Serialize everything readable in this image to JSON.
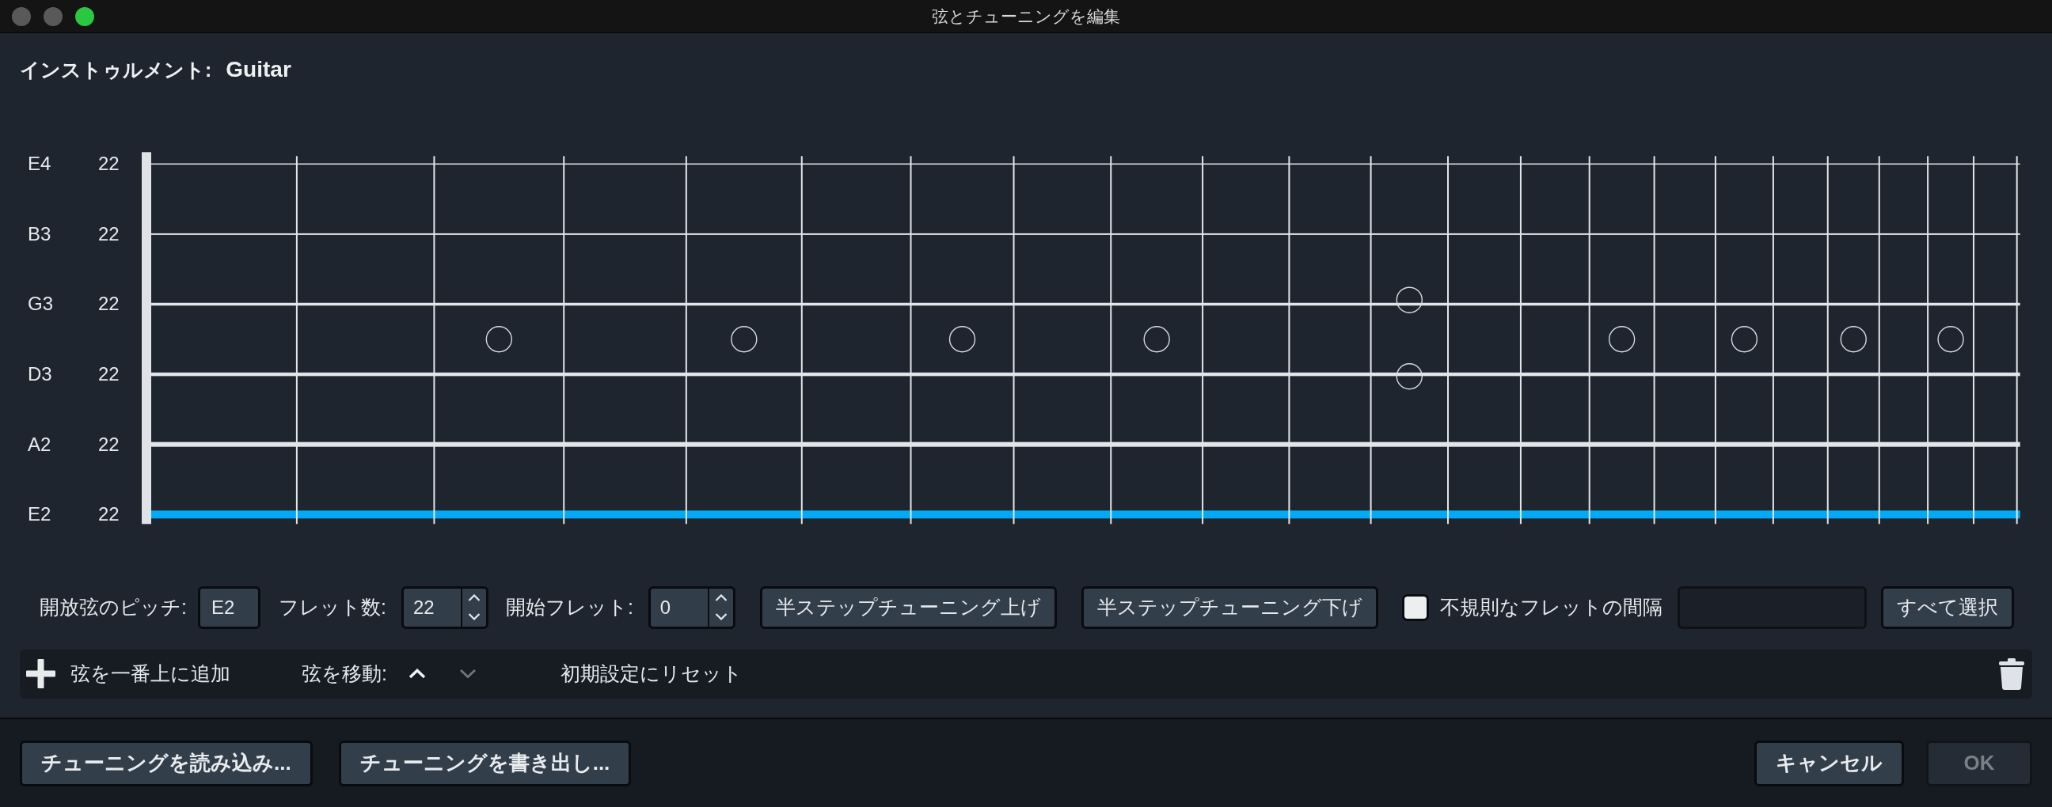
{
  "window": {
    "title": "弦とチューニングを編集",
    "controls": [
      {
        "kind": "close",
        "disabled": true
      },
      {
        "kind": "minimize",
        "disabled": true
      },
      {
        "kind": "zoom",
        "disabled": false
      }
    ]
  },
  "instrument": {
    "label": "インストゥルメント:",
    "name": "Guitar"
  },
  "strings": [
    {
      "pitch": "E4",
      "frets": "22",
      "selected": false
    },
    {
      "pitch": "B3",
      "frets": "22",
      "selected": false
    },
    {
      "pitch": "G3",
      "frets": "22",
      "selected": false
    },
    {
      "pitch": "D3",
      "frets": "22",
      "selected": false
    },
    {
      "pitch": "A2",
      "frets": "22",
      "selected": false
    },
    {
      "pitch": "E2",
      "frets": "22",
      "selected": true
    }
  ],
  "string_settings": {
    "open_pitch_label": "開放弦のピッチ:",
    "open_pitch": "E2",
    "fret_count_label": "フレット数:",
    "fret_count": "22",
    "start_fret_label": "開始フレット:",
    "start_fret": "0",
    "half_step_up": "半ステップチューニング上げ",
    "half_step_down": "半ステップチューニング下げ",
    "irregular_spacing": {
      "label": "不規則なフレットの間隔",
      "checked": false
    },
    "select_all": "すべて選択"
  },
  "toolbar": {
    "add_string": "弦を一番上に追加",
    "move_label": "弦を移動:",
    "move_up": {
      "disabled": false
    },
    "move_down": {
      "disabled": true
    },
    "reset": "初期設定にリセット"
  },
  "footer": {
    "load_tuning": "チューニングを読み込み...",
    "save_tuning": "チューニングを書き出し...",
    "cancel": "キャンセル",
    "ok": {
      "label": "OK",
      "disabled": true
    }
  }
}
